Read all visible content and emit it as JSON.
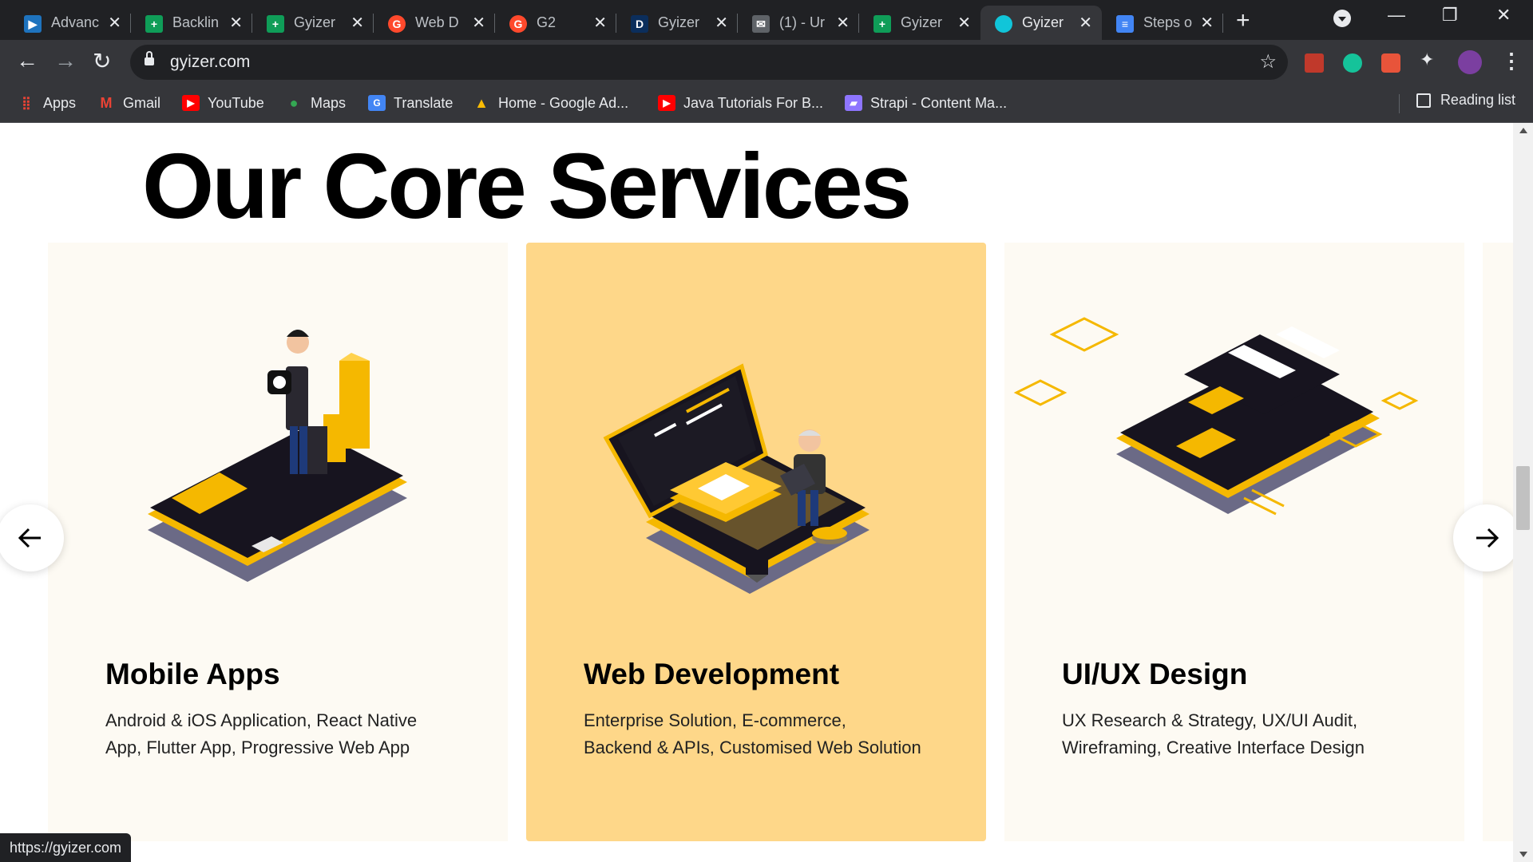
{
  "browser": {
    "tabs": [
      {
        "title": "Advanc",
        "favicon": "play-icon",
        "color": "#1e73be"
      },
      {
        "title": "Backlin",
        "favicon": "sheets-icon",
        "color": "#0f9d58"
      },
      {
        "title": "Gyizer",
        "favicon": "sheets-icon",
        "color": "#0f9d58"
      },
      {
        "title": "Web D",
        "favicon": "g2-icon",
        "color": "#ff492c"
      },
      {
        "title": "G2",
        "favicon": "g2-icon",
        "color": "#ff492c"
      },
      {
        "title": "Gyizer",
        "favicon": "d-icon",
        "color": "#0b2e5c"
      },
      {
        "title": "(1) - Ur",
        "favicon": "mail-icon",
        "color": "#5f6368"
      },
      {
        "title": "Gyizer",
        "favicon": "sheets-icon",
        "color": "#0f9d58"
      },
      {
        "title": "Gyizer",
        "favicon": "gyizer-icon",
        "color": "#11c5d9",
        "active": true
      },
      {
        "title": "Steps o",
        "favicon": "docs-icon",
        "color": "#4285f4"
      }
    ],
    "url": "gyizer.com",
    "bookmarks": [
      {
        "label": "Apps",
        "icon": "apps-grid-icon",
        "color": "#ea4335"
      },
      {
        "label": "Gmail",
        "icon": "gmail-icon",
        "color": "#ea4335"
      },
      {
        "label": "YouTube",
        "icon": "youtube-icon",
        "color": "#ff0000"
      },
      {
        "label": "Maps",
        "icon": "maps-pin-icon",
        "color": "#34a853"
      },
      {
        "label": "Translate",
        "icon": "translate-icon",
        "color": "#4285f4"
      },
      {
        "label": "Home - Google Ad...",
        "icon": "google-ads-icon",
        "color": "#fbbc04"
      },
      {
        "label": "Java Tutorials For B...",
        "icon": "youtube-icon",
        "color": "#ff0000"
      },
      {
        "label": "Strapi - Content Ma...",
        "icon": "strapi-icon",
        "color": "#8e75ff"
      }
    ],
    "reading_list": "Reading list",
    "status_url": "https://gyizer.com"
  },
  "page": {
    "heading": "Our Core Services",
    "accent_color": "#fed789",
    "cards": [
      {
        "title": "Mobile Apps",
        "desc_line1": "Android & iOS Application, React Native",
        "desc_line2": "App, Flutter App, Progressive Web App"
      },
      {
        "title": "Web Development",
        "desc_line1": "Enterprise Solution, E-commerce,",
        "desc_line2": "Backend & APIs, Customised Web Solution"
      },
      {
        "title": "UI/UX Design",
        "desc_line1": "UX Research & Strategy, UX/UI Audit,",
        "desc_line2": "Wireframing, Creative Interface Design"
      }
    ]
  }
}
